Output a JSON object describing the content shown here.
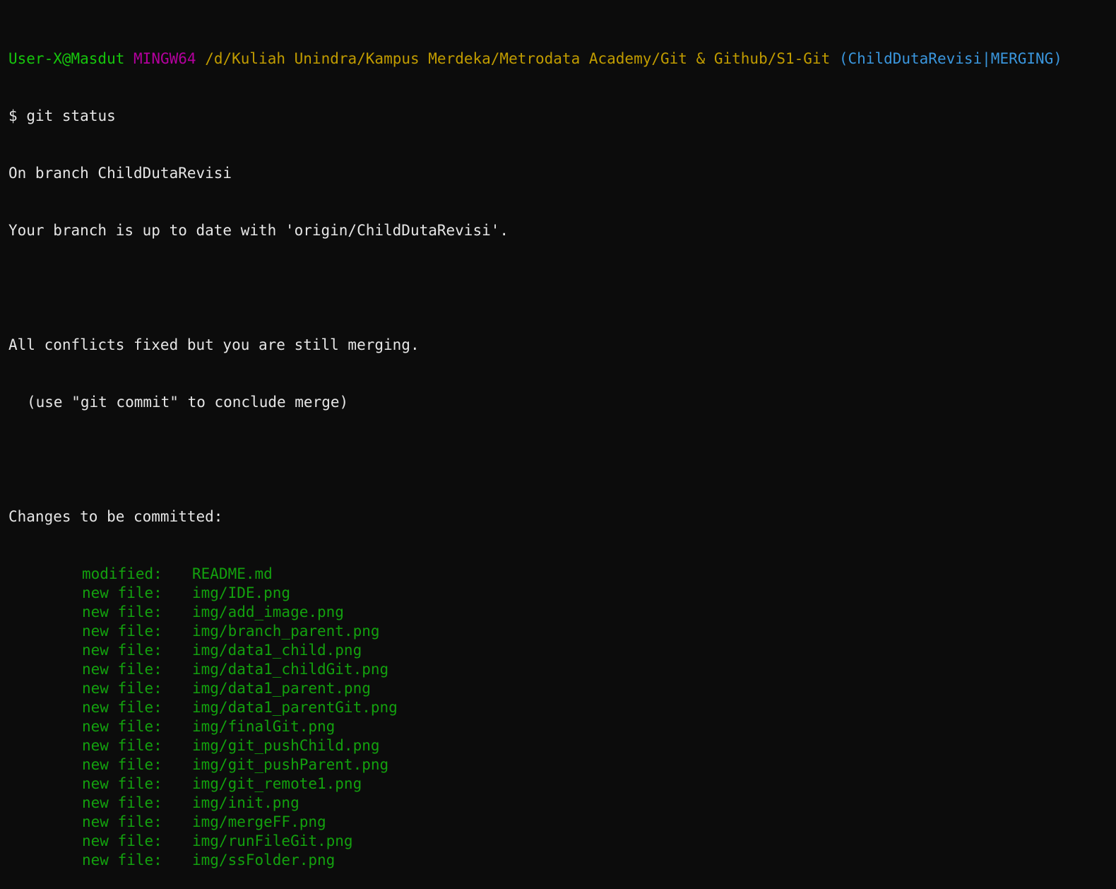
{
  "colors": {
    "background": "#0c0c0c",
    "text": "#e6e6e6",
    "user_host": "#16c60c",
    "system": "#b4009e",
    "path": "#c19c00",
    "branch": "#3a96dd",
    "staged": "#13a10e"
  },
  "prompt": {
    "user_host": "User-X@Masdut",
    "system": "MINGW64",
    "path": "/d/Kuliah Unindra/Kampus Merdeka/Metrodata Academy/Git & Github/S1-Git",
    "branch": "(ChildDutaRevisi|MERGING)"
  },
  "command": {
    "symbol": "$",
    "text": "git status"
  },
  "output": {
    "on_branch": "On branch ChildDutaRevisi",
    "up_to_date": "Your branch is up to date with 'origin/ChildDutaRevisi'.",
    "conflicts_fixed": "All conflicts fixed but you are still merging.",
    "commit_hint": "(use \"git commit\" to conclude merge)",
    "changes_header": "Changes to be committed:",
    "staged": [
      {
        "status": "modified:",
        "file": "README.md"
      },
      {
        "status": "new file:",
        "file": "img/IDE.png"
      },
      {
        "status": "new file:",
        "file": "img/add_image.png"
      },
      {
        "status": "new file:",
        "file": "img/branch_parent.png"
      },
      {
        "status": "new file:",
        "file": "img/data1_child.png"
      },
      {
        "status": "new file:",
        "file": "img/data1_childGit.png"
      },
      {
        "status": "new file:",
        "file": "img/data1_parent.png"
      },
      {
        "status": "new file:",
        "file": "img/data1_parentGit.png"
      },
      {
        "status": "new file:",
        "file": "img/finalGit.png"
      },
      {
        "status": "new file:",
        "file": "img/git_pushChild.png"
      },
      {
        "status": "new file:",
        "file": "img/git_pushParent.png"
      },
      {
        "status": "new file:",
        "file": "img/git_remote1.png"
      },
      {
        "status": "new file:",
        "file": "img/init.png"
      },
      {
        "status": "new file:",
        "file": "img/mergeFF.png"
      },
      {
        "status": "new file:",
        "file": "img/runFileGit.png"
      },
      {
        "status": "new file:",
        "file": "img/ssFolder.png"
      }
    ]
  }
}
